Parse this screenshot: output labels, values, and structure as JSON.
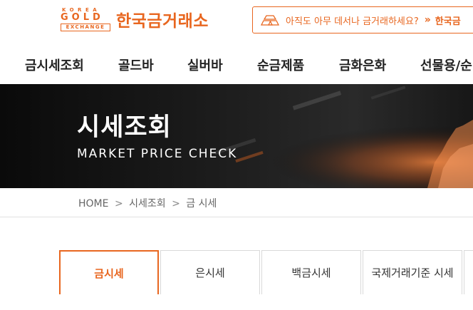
{
  "logo": {
    "korea": "KOREA",
    "gold": "GOLD",
    "exchange": "EXCHANGE",
    "name": "한국금거래소"
  },
  "promo": {
    "text": "아직도 아무 데서나 금거래하세요?",
    "arrow": "»",
    "link": "한국금"
  },
  "gnb": {
    "items": [
      "금시세조회",
      "골드바",
      "실버바",
      "순금제품",
      "금화은화",
      "선물용/순"
    ]
  },
  "hero": {
    "title": "시세조회",
    "subtitle": "MARKET PRICE CHECK"
  },
  "breadcrumb": {
    "home": "HOME",
    "sep": ">",
    "level1": "시세조회",
    "level2": "금 시세"
  },
  "tabs": [
    {
      "label": "금시세",
      "active": true
    },
    {
      "label": "은시세",
      "active": false
    },
    {
      "label": "백금시세",
      "active": false
    },
    {
      "label": "국제거래기준 시세",
      "active": false
    }
  ],
  "colors": {
    "accent": "#e8661f",
    "hero_bg": "#0d0d0d"
  }
}
